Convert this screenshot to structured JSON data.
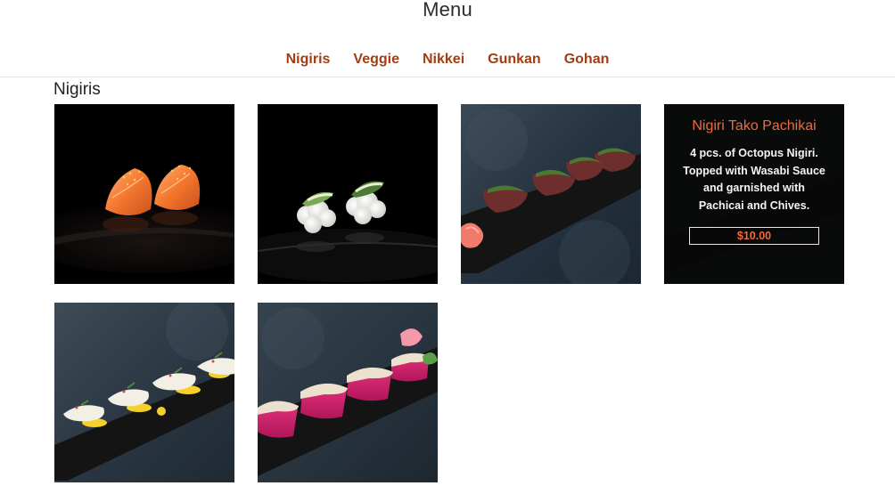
{
  "header": {
    "title": "Menu"
  },
  "nav": {
    "categories": [
      "Nigiris",
      "Veggie",
      "Nikkei",
      "Gunkan",
      "Gohan"
    ],
    "link_color": "#a23d14"
  },
  "section": {
    "title": "Nigiris"
  },
  "items": [
    {
      "image": "salmon-nigiri-photo"
    },
    {
      "image": "cauliflower-nigiri-photo"
    },
    {
      "image": "seared-beef-nigiri-photo"
    },
    {
      "image": "octopus-nigiri-photo",
      "overlay": {
        "name": "Nigiri Tako Pachikai",
        "description": "4 pcs. of Octopus Nigiri. Topped with Wasabi Sauce and garnished with Pachicai and Chives.",
        "price": "$10.00"
      }
    },
    {
      "image": "white-fish-nigiri-photo"
    },
    {
      "image": "tuna-nigiri-photo"
    }
  ],
  "colors": {
    "accent": "#f06a3a",
    "overlay_bg": "#080808"
  }
}
